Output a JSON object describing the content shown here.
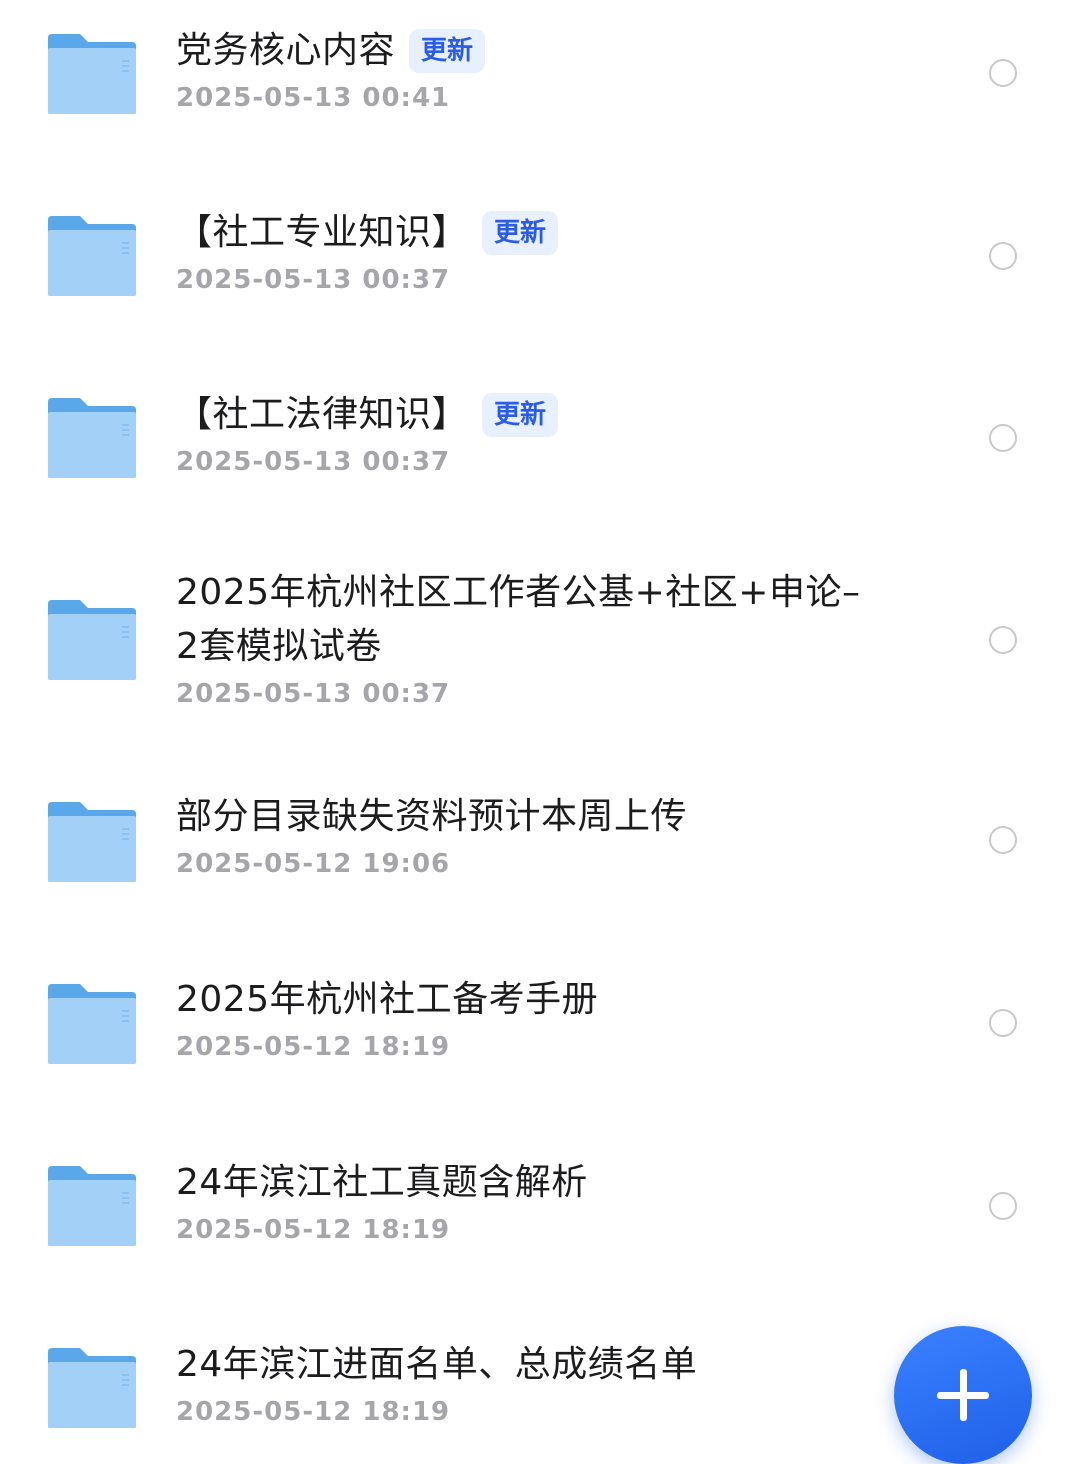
{
  "items": [
    {
      "title": "党务核心内容",
      "badge": "更新",
      "date": "2025-05-13 00:41"
    },
    {
      "title": "【社工专业知识】",
      "badge": "更新",
      "date": "2025-05-13 00:37"
    },
    {
      "title": "【社工法律知识】",
      "badge": "更新",
      "date": "2025-05-13 00:37"
    },
    {
      "title": "2025年杭州社区工作者公基+社区+申论–2套模拟试卷",
      "date": "2025-05-13 00:37"
    },
    {
      "title": "部分目录缺失资料预计本周上传",
      "date": "2025-05-12 19:06"
    },
    {
      "title": "2025年杭州社工备考手册",
      "date": "2025-05-12 18:19"
    },
    {
      "title": "24年滨江社工真题含解析",
      "date": "2025-05-12 18:19"
    },
    {
      "title": "24年滨江进面名单、总成绩名单",
      "date": "2025-05-12 18:19"
    }
  ],
  "icons": {
    "folder": "folder-icon",
    "select": "radio-circle",
    "add": "plus-icon"
  },
  "colors": {
    "accent": "#2b5ce6",
    "badge_bg": "#e8effd",
    "folder_light": "#a9d4f8",
    "folder_dark": "#6cb3ee"
  }
}
